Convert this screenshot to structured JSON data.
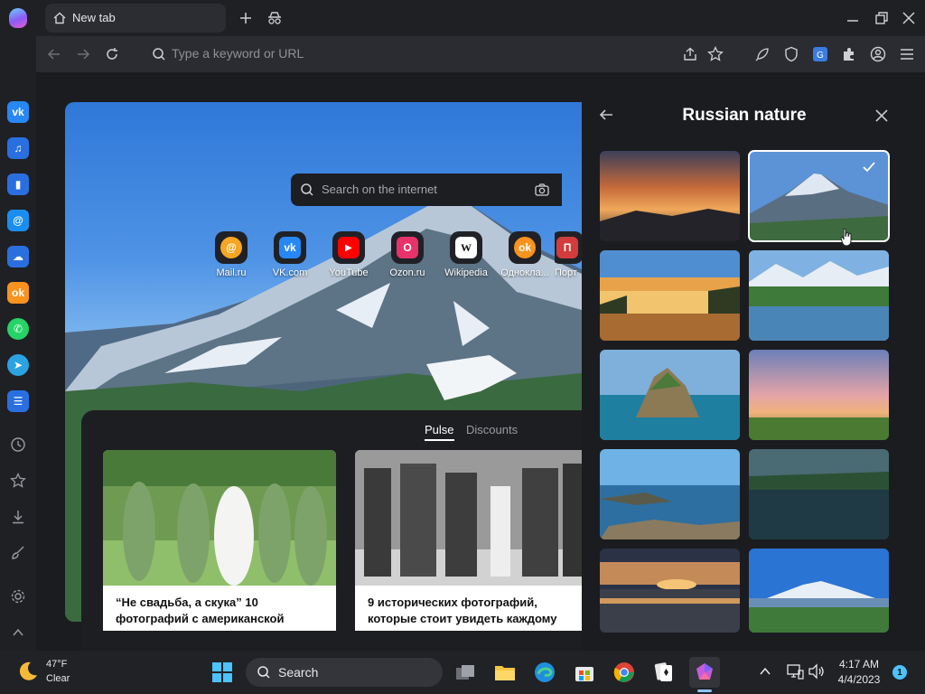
{
  "browser": {
    "tab_title": "New tab",
    "address_placeholder": "Type a keyword or URL"
  },
  "newtab": {
    "search_placeholder": "Search on the internet",
    "tiles": [
      {
        "label": "Mail.ru",
        "icon": "mailru-icon",
        "color": "#f5a623"
      },
      {
        "label": "VK.com",
        "icon": "vk-icon",
        "color": "#2787f5"
      },
      {
        "label": "YouTube",
        "icon": "youtube-icon",
        "color": "#ff0000"
      },
      {
        "label": "Ozon.ru",
        "icon": "ozon-icon",
        "color": "#e8326b"
      },
      {
        "label": "Wikipedia",
        "icon": "wikipedia-icon",
        "color": "#ffffff"
      },
      {
        "label": "Одноклa...",
        "icon": "odnoklassniki-icon",
        "color": "#f7931e"
      },
      {
        "label": "Порт",
        "icon": "portal-icon",
        "color": "#d23c3c"
      }
    ],
    "feed": {
      "tabs": [
        "Pulse",
        "Discounts"
      ],
      "active_tab": "Pulse",
      "articles": [
        {
          "title": "“Не свадьба, а скука” 10 фотографий с американской"
        },
        {
          "title": "9 исторических фотографий, которые стоит увидеть каждому"
        }
      ]
    }
  },
  "wallpaper_panel": {
    "title": "Russian nature",
    "selected_index": 1
  },
  "taskbar": {
    "weather_temp": "47°F",
    "weather_desc": "Clear",
    "search_label": "Search",
    "time": "4:17 AM",
    "date": "4/4/2023",
    "notification_count": "1"
  }
}
